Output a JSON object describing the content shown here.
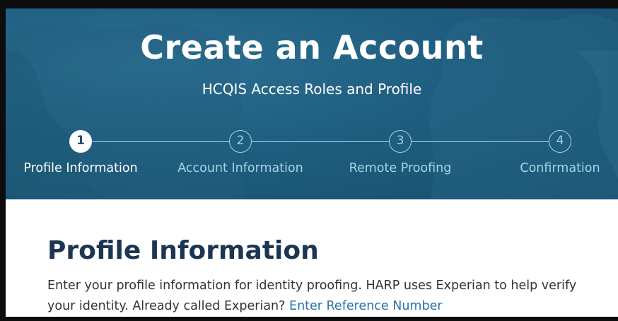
{
  "header": {
    "title": "Create an Account",
    "subtitle": "HCQIS Access Roles and Profile"
  },
  "stepper": {
    "steps": [
      {
        "number": "1",
        "label": "Profile Information",
        "active": true
      },
      {
        "number": "2",
        "label": "Account Information",
        "active": false
      },
      {
        "number": "3",
        "label": "Remote Proofing",
        "active": false
      },
      {
        "number": "4",
        "label": "Confirmation",
        "active": false
      }
    ]
  },
  "main": {
    "heading": "Profile Information",
    "description": "Enter your profile information for identity proofing. HARP uses Experian to help verify your identity. Already called Experian?",
    "reference_link": "Enter Reference Number"
  },
  "colors": {
    "hero_background": "#1f5e80",
    "step_inactive": "#a7d4e8",
    "heading": "#1c3553",
    "link": "#2a73a8"
  }
}
